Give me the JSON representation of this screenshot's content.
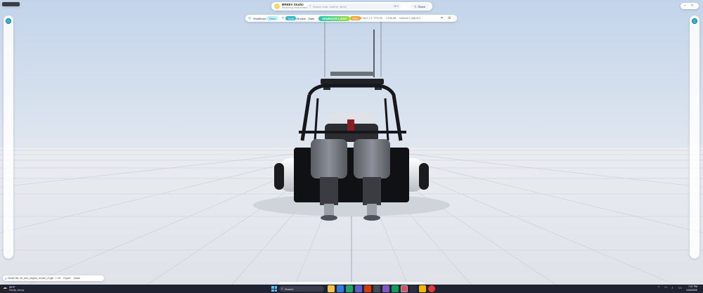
{
  "app": {
    "name": "BREEV Studio",
    "subtitle": "Rendering environment",
    "search_placeholder": "Search boat, marine, items",
    "search_shortcut": "⌘ K",
    "share_label": "Share"
  },
  "window_tab": {
    "label": ""
  },
  "toolbar": {
    "items": [
      "Workflows",
      "View",
      "Tools",
      "Models",
      "Stats"
    ],
    "sun_label": "Sun",
    "active_badge": "GENERATE LIGHT",
    "orange_badge": "PRO",
    "readouts": [
      "SCALE 1:1",
      "FPS 60",
      "1,046 kB",
      "Vertices 1,268,413"
    ]
  },
  "status_bar": {
    "file_label": "Model file: rib_twin_engine_render_v3.glb",
    "size": "1 MB",
    "buttons": [
      "Export",
      "Share"
    ]
  },
  "taskbar": {
    "weather_temp": "39°F",
    "weather_text": "Mostly cloudy",
    "search_label": "Search",
    "time": "7:07 PM",
    "date": "1/26/2026"
  },
  "colors": {
    "sky_top": "#c6d6ea",
    "horizon": "#e8ecf2",
    "floor": "#e6e9ee",
    "accent": "#2fb6c9",
    "active_badge_start": "#1ec8b4",
    "active_badge_end": "#9ee03a",
    "orange": "#f3a53b",
    "taskbar": "#1f2230"
  }
}
